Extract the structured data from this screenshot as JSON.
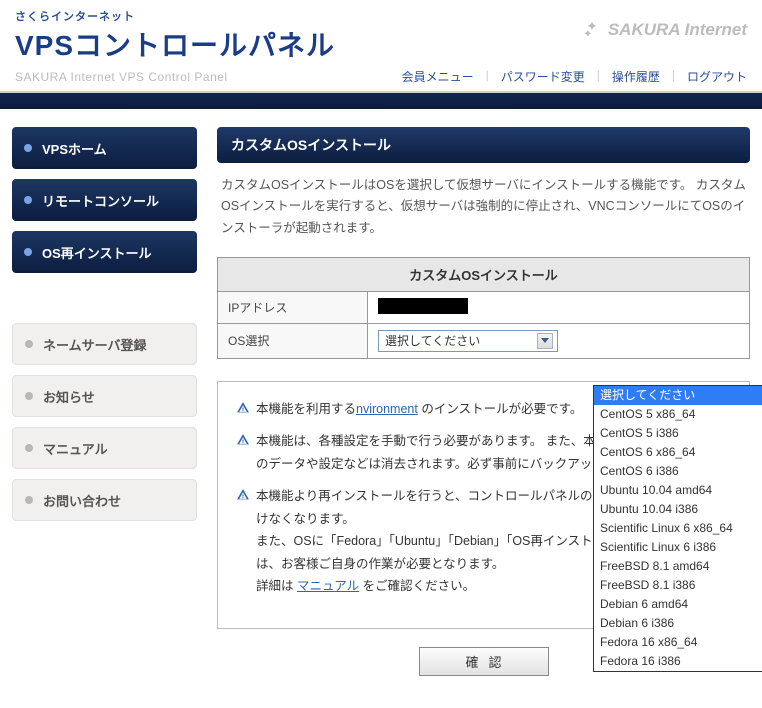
{
  "brand": {
    "super": "さくらインターネット",
    "main": "VPSコントロールパネル",
    "right": "SAKURA Internet"
  },
  "subbar": {
    "caption": "SAKURA Internet VPS Control Panel",
    "menu": [
      "会員メニュー",
      "パスワード変更",
      "操作履歴",
      "ログアウト"
    ]
  },
  "sidebar": {
    "primary": [
      {
        "label": "VPSホーム"
      },
      {
        "label": "リモートコンソール"
      },
      {
        "label": "OS再インストール"
      }
    ],
    "secondary": [
      {
        "label": "ネームサーバ登録"
      },
      {
        "label": "お知らせ"
      },
      {
        "label": "マニュアル"
      },
      {
        "label": "お問い合わせ"
      }
    ]
  },
  "page": {
    "title": "カスタムOSインストール",
    "lead": "カスタムOSインストールはOSを選択して仮想サーバにインストールする機能です。 カスタムOSインストールを実行すると、仮想サーバは強制的に停止され、VNCコンソールにてOSのインストーラが起動されます。",
    "table_caption": "カスタムOSインストール",
    "ip_label": "IPアドレス",
    "os_label": "OS選択",
    "select_placeholder": "選択してください",
    "options": [
      "選択してください",
      "CentOS 5 x86_64",
      "CentOS 5 i386",
      "CentOS 6 x86_64",
      "CentOS 6 i386",
      "Ubuntu 10.04 amd64",
      "Ubuntu 10.04 i386",
      "Scientific Linux 6 x86_64",
      "Scientific Linux 6 i386",
      "FreeBSD 8.1 amd64",
      "FreeBSD 8.1 i386",
      "Debian 6 amd64",
      "Debian 6 i386",
      "Fedora 16 x86_64",
      "Fedora 16 i386"
    ],
    "selected_index": 0,
    "notices": {
      "n1_a": "本機能を利用する",
      "n1_link": "nvironment",
      "n1_b": " のインストールが必要です。",
      "n2": "本機能は、各種設定を手動で行う必要があります。 また、本機能を実行すると既存のデータや設定などは消去されます。必ず事前にバックアップをお取りください。",
      "n3_a": "本機能より再インストールを行うと、コントロールパネルの一部機能がご利用いただけなくなります。",
      "n3_b": "また、OSに「Fedora」「Ubuntu」「Debian」「OS再インストール」を使用する際には、お客様ご自身の作業が必要となります。",
      "n3_c": "詳細は ",
      "n3_link": "マニュアル",
      "n3_d": " をご確認ください。"
    },
    "confirm": "確認"
  }
}
